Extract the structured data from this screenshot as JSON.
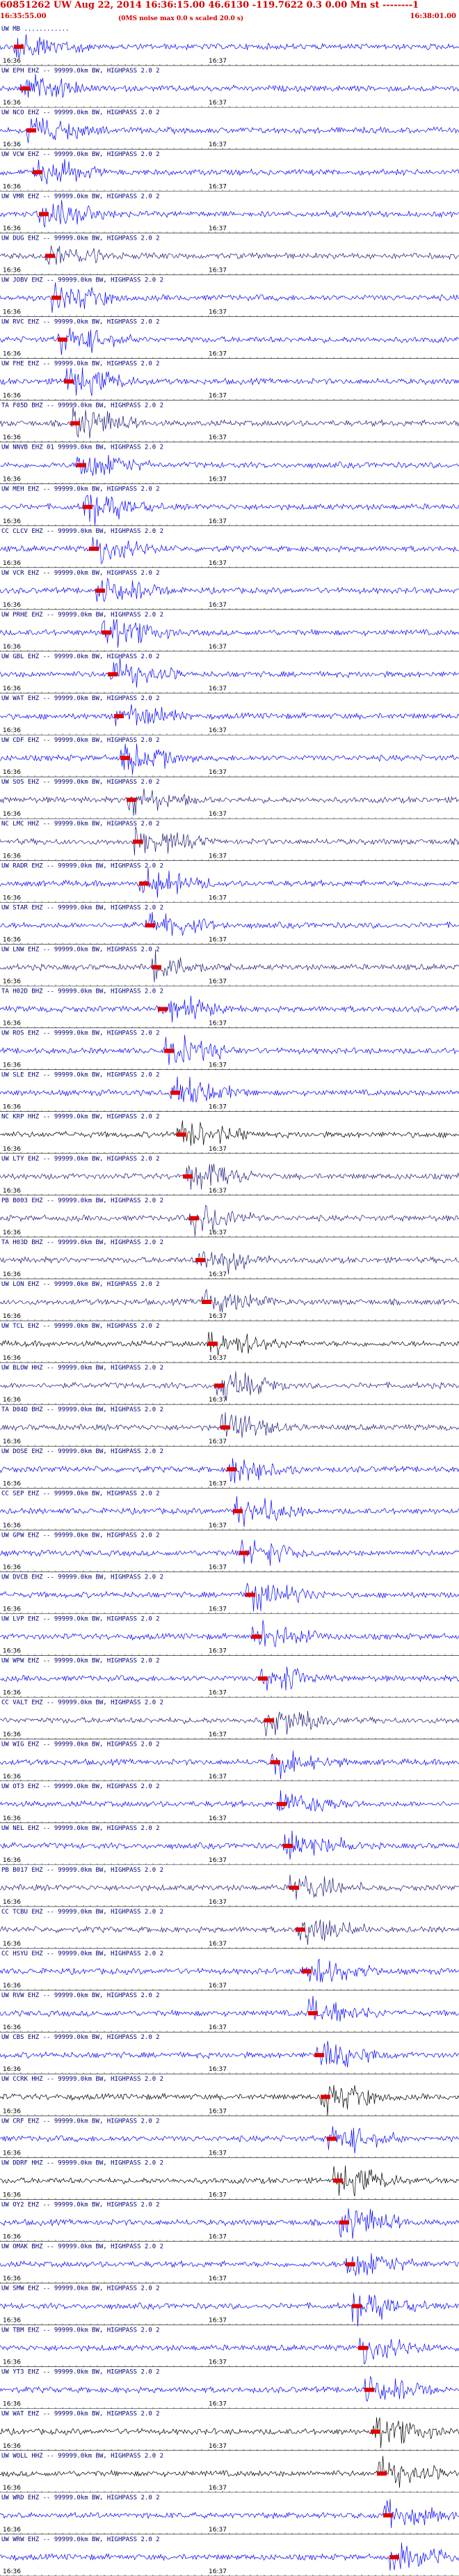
{
  "header": {
    "title": "60851262 UW Aug 22, 2014 16:36:15.00   46.6130 -119.7622  0.3 0.00 Mn st --------1",
    "start_time": "16:35:55.00",
    "subtitle": "(0MS noise max 0.0 s scaled 20.0 s)",
    "end_time": "16:38:01.00"
  },
  "axis": {
    "tick_labels": [
      "16:36",
      "16:37"
    ]
  },
  "colors": {
    "blue": "#0000ff",
    "navy": "#1a1a7a",
    "black": "#000000",
    "pick": "#e00000"
  },
  "channels": [
    {
      "label": "UW MB ............",
      "color": "blue"
    },
    {
      "label": "UW EPH EHZ -- 99999.0km BW, HIGHPASS 2.0 2",
      "color": "blue"
    },
    {
      "label": "UW NCO EHZ -- 99999.0km BW, HIGHPASS 2.0 2",
      "color": "blue"
    },
    {
      "label": "UW VCW EHZ -- 99999.0km BW, HIGHPASS 2.0 2",
      "color": "blue"
    },
    {
      "label": "UW VMR EHZ -- 99999.0km BW, HIGHPASS 2.0 2",
      "color": "blue"
    },
    {
      "label": "UW DUG EHZ -- 99999.0km BW, HIGHPASS 2.0 2",
      "color": "navy"
    },
    {
      "label": "UW JOBV EHZ -- 99999.0km BW, HIGHPASS 2.0 2",
      "color": "blue"
    },
    {
      "label": "UW RVC EHZ -- 99999.0km BW, HIGHPASS 2.0 2",
      "color": "blue"
    },
    {
      "label": "UW FHE EHZ -- 99999.0km BW, HIGHPASS 2.0 2",
      "color": "blue"
    },
    {
      "label": "TA F05D BHZ -- 99999.0km BW, HIGHPASS 2.0 2",
      "color": "navy"
    },
    {
      "label": "UW NNVB EHZ 01 99999.0km BW, HIGHPASS 2.0 2",
      "color": "blue"
    },
    {
      "label": "UW MEH EHZ -- 99999.0km BW, HIGHPASS 2.0 2",
      "color": "blue"
    },
    {
      "label": "CC CLCV EHZ -- 99999.0km BW, HIGHPASS 2.0 2",
      "color": "blue"
    },
    {
      "label": "UW VCR EHZ -- 99999.0km BW, HIGHPASS 2.0 2",
      "color": "blue"
    },
    {
      "label": "UW PRHE EHZ -- 99999.0km BW, HIGHPASS 2.0 2",
      "color": "blue"
    },
    {
      "label": "UW GBL EHZ -- 99999.0km BW, HIGHPASS 2.0 2",
      "color": "blue"
    },
    {
      "label": "UW WAT EHZ -- 99999.0km BW, HIGHPASS 2.0 2",
      "color": "blue"
    },
    {
      "label": "UW CDF EHZ -- 99999.0km BW, HIGHPASS 2.0 2",
      "color": "blue"
    },
    {
      "label": "UW SOS EHZ -- 99999.0km BW, HIGHPASS 2.0 2",
      "color": "navy"
    },
    {
      "label": "NC LMC HHZ -- 99999.0km BW, HIGHPASS 2.0 2",
      "color": "navy"
    },
    {
      "label": "UW RADR EHZ -- 99999.0km BW, HIGHPASS 2.0 2",
      "color": "blue"
    },
    {
      "label": "UW STAR EHZ -- 99999.0km BW, HIGHPASS 2.0 2",
      "color": "blue"
    },
    {
      "label": "UW LNW EHZ -- 99999.0km BW, HIGHPASS 2.0 2",
      "color": "navy"
    },
    {
      "label": "TA H02D BHZ -- 99999.0km BW, HIGHPASS 2.0 2",
      "color": "blue"
    },
    {
      "label": "UW ROS EHZ -- 99999.0km BW, HIGHPASS 2.0 2",
      "color": "blue"
    },
    {
      "label": "UW SLE EHZ -- 99999.0km BW, HIGHPASS 2.0 2",
      "color": "blue"
    },
    {
      "label": "NC KRP HHZ -- 99999.0km BW, HIGHPASS 2.0 2",
      "color": "black"
    },
    {
      "label": "UW LTY EHZ -- 99999.0km BW, HIGHPASS 2.0 2",
      "color": "navy"
    },
    {
      "label": "PB B003 EHZ -- 99999.0km BW, HIGHPASS 2.0 2",
      "color": "navy"
    },
    {
      "label": "TA H03D BHZ -- 99999.0km BW, HIGHPASS 2.0 2",
      "color": "navy"
    },
    {
      "label": "UW LON EHZ -- 99999.0km BW, HIGHPASS 2.0 2",
      "color": "navy"
    },
    {
      "label": "UW TCL EHZ -- 99999.0km BW, HIGHPASS 2.0 2",
      "color": "black"
    },
    {
      "label": "UW BLOW HHZ -- 99999.0km BW, HIGHPASS 2.0 2",
      "color": "navy"
    },
    {
      "label": "TA D04D BHZ -- 99999.0km BW, HIGHPASS 2.0 2",
      "color": "navy"
    },
    {
      "label": "UW DOSE EHZ -- 99999.0km BW, HIGHPASS 2.0 2",
      "color": "blue"
    },
    {
      "label": "CC SEP EHZ -- 99999.0km BW, HIGHPASS 2.0 2",
      "color": "blue"
    },
    {
      "label": "UW GPW EHZ -- 99999.0km BW, HIGHPASS 2.0 2",
      "color": "blue"
    },
    {
      "label": "UW DVCB EHZ -- 99999.0km BW, HIGHPASS 2.0 2",
      "color": "blue"
    },
    {
      "label": "UW LVP EHZ -- 99999.0km BW, HIGHPASS 2.0 2",
      "color": "blue"
    },
    {
      "label": "UW WPW EHZ -- 99999.0km BW, HIGHPASS 2.0 2",
      "color": "blue"
    },
    {
      "label": "CC VALT EHZ -- 99999.0km BW, HIGHPASS 2.0 2",
      "color": "navy"
    },
    {
      "label": "UW WIG EHZ -- 99999.0km BW, HIGHPASS 2.0 2",
      "color": "blue"
    },
    {
      "label": "UW OT3 EHZ -- 99999.0km BW, HIGHPASS 2.0 2",
      "color": "blue"
    },
    {
      "label": "UW NEL EHZ -- 99999.0km BW, HIGHPASS 2.0 2",
      "color": "blue"
    },
    {
      "label": "PB B017 EHZ -- 99999.0km BW, HIGHPASS 2.0 2",
      "color": "navy"
    },
    {
      "label": "CC TCBU EHZ -- 99999.0km BW, HIGHPASS 2.0 2",
      "color": "navy"
    },
    {
      "label": "CC HSYU EHZ -- 99999.0km BW, HIGHPASS 2.0 2",
      "color": "blue"
    },
    {
      "label": "UW RVW EHZ -- 99999.0km BW, HIGHPASS 2.0 2",
      "color": "blue"
    },
    {
      "label": "UW CBS EHZ -- 99999.0km BW, HIGHPASS 2.0 2",
      "color": "blue"
    },
    {
      "label": "UW CCRK HHZ -- 99999.0km BW, HIGHPASS 2.0 2",
      "color": "black"
    },
    {
      "label": "UW CRF EHZ -- 99999.0km BW, HIGHPASS 2.0 2",
      "color": "blue"
    },
    {
      "label": "UW DDRF HHZ -- 99999.0km BW, HIGHPASS 2.0 2",
      "color": "black"
    },
    {
      "label": "UW OY2 EHZ -- 99999.0km BW, HIGHPASS 2.0 2",
      "color": "blue"
    },
    {
      "label": "UW OMAK BHZ -- 99999.0km BW, HIGHPASS 2.0 2",
      "color": "blue"
    },
    {
      "label": "UW SMW EHZ -- 99999.0km BW, HIGHPASS 2.0 2",
      "color": "blue"
    },
    {
      "label": "UW TBM EHZ -- 99999.0km BW, HIGHPASS 2.0 2",
      "color": "blue"
    },
    {
      "label": "UW YT3 EHZ -- 99999.0km BW, HIGHPASS 2.0 2",
      "color": "blue"
    },
    {
      "label": "UW WAT EHZ -- 99999.0km BW, HIGHPASS 2.0 2",
      "color": "black"
    },
    {
      "label": "UW WOLL HHZ -- 99999.0km BW, HIGHPASS 2.0 2",
      "color": "black"
    },
    {
      "label": "UW WRD EHZ -- 99999.0km BW, HIGHPASS 2.0 2",
      "color": "blue"
    },
    {
      "label": "UW WRW EHZ -- 99999.0km BW, HIGHPASS 2.0 2",
      "color": "blue"
    }
  ]
}
